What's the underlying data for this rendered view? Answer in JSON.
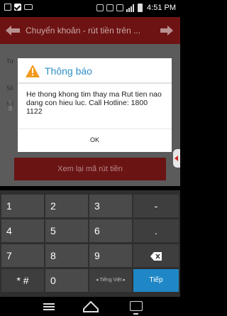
{
  "status_bar": {
    "time": "4:51 PM"
  },
  "app_bar": {
    "title": "Chuyển khoản - rút tiền trên ..."
  },
  "form": {
    "label_fragments": [
      "Từ",
      "Số",
      "Số"
    ],
    "review_button": "Xem lại mã rút tiền"
  },
  "dialog": {
    "title": "Thông báo",
    "message": "He thong khong tim thay ma Rut tien nao dang con hieu luc. Call Hotline: 1800 1122",
    "ok_label": "OK"
  },
  "keyboard": {
    "row1": [
      "1",
      "2",
      "3",
      "-"
    ],
    "row2": [
      "4",
      "5",
      "6",
      "."
    ],
    "row3": [
      "7",
      "8",
      "9"
    ],
    "row4": {
      "symbols": "* #",
      "zero": "0",
      "language": "◂ Tiếng Việt ▸",
      "enter": "Tiếp"
    }
  },
  "colors": {
    "accent": "#2d8fc9",
    "brand_red": "#c62828",
    "key_blue": "#1f87c6"
  }
}
